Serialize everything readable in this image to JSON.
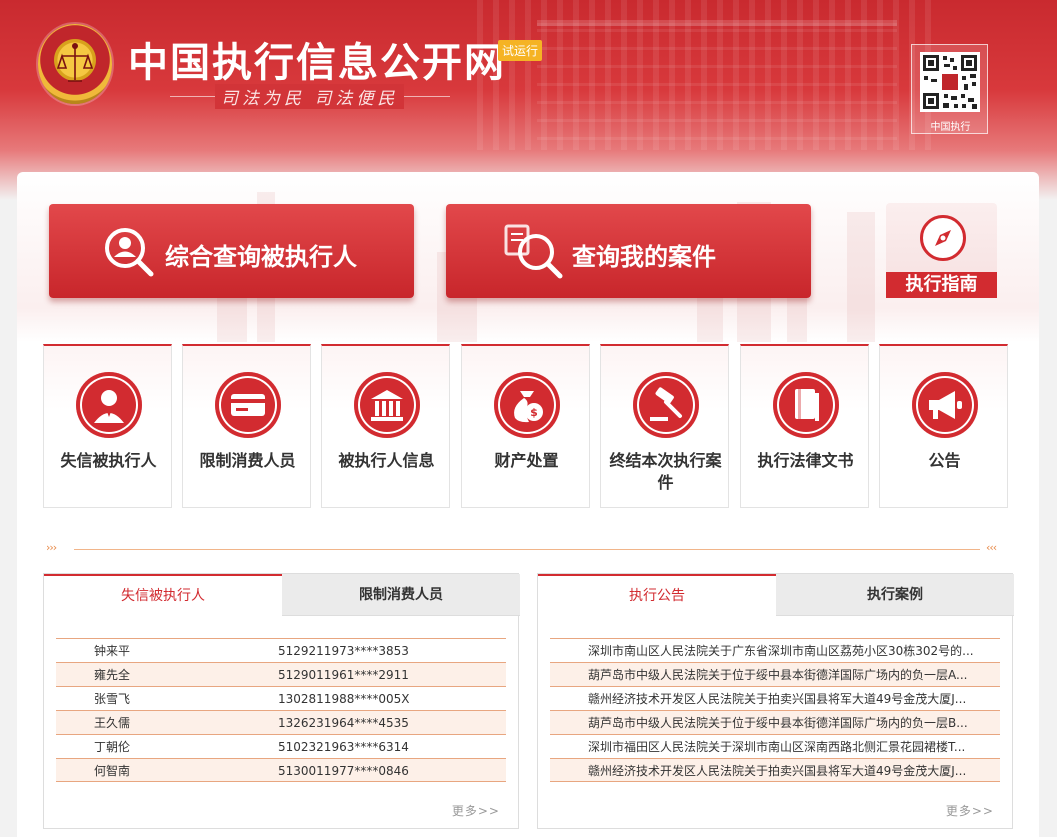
{
  "header": {
    "site_title": "中国执行信息公开网",
    "beta_badge": "试运行",
    "slogan": "司法为民  司法便民",
    "qr_label": "中国执行",
    "icons": {
      "emblem": "national-emblem-icon",
      "qr": "qr-code-icon"
    }
  },
  "actions": {
    "query_executed": {
      "label": "综合查询被执行人",
      "icon": "person-search-icon"
    },
    "query_my_case": {
      "label": "查询我的案件",
      "icon": "document-search-icon"
    },
    "guide": {
      "label": "执行指南",
      "icon": "compass-icon"
    }
  },
  "tiles": [
    {
      "label": "失信被执行人",
      "icon": "person-icon"
    },
    {
      "label": "限制消费人员",
      "icon": "card-icon"
    },
    {
      "label": "被执行人信息",
      "icon": "courthouse-icon"
    },
    {
      "label": "财产处置",
      "icon": "money-bag-icon"
    },
    {
      "label": "终结本次执行案件",
      "icon": "gavel-icon"
    },
    {
      "label": "执行法律文书",
      "icon": "book-icon"
    },
    {
      "label": "公告",
      "icon": "megaphone-icon"
    }
  ],
  "divider": {
    "left": "›››",
    "right": "‹‹‹"
  },
  "left_panel": {
    "tabs": [
      "失信被执行人",
      "限制消费人员"
    ],
    "active_tab": 0,
    "rows": [
      {
        "name": "钟来平",
        "id": "5129211973****3853"
      },
      {
        "name": "雍先全",
        "id": "5129011961****2911"
      },
      {
        "name": "张雪飞",
        "id": "1302811988****005X"
      },
      {
        "name": "王久儒",
        "id": "1326231964****4535"
      },
      {
        "name": "丁朝伦",
        "id": "5102321963****6314"
      },
      {
        "name": "何智南",
        "id": "5130011977****0846"
      }
    ],
    "more": "更多>>"
  },
  "right_panel": {
    "tabs": [
      "执行公告",
      "执行案例"
    ],
    "active_tab": 0,
    "rows": [
      "深圳市南山区人民法院关于广东省深圳市南山区荔苑小区30栋302号的...",
      "葫芦岛市中级人民法院关于位于绥中县本街德洋国际广场内的负一层A...",
      "赣州经济技术开发区人民法院关于拍卖兴国县将军大道49号金茂大厦J...",
      "葫芦岛市中级人民法院关于位于绥中县本街德洋国际广场内的负一层B...",
      "深圳市福田区人民法院关于深圳市南山区深南西路北侧汇景花园裙楼T...",
      "赣州经济技术开发区人民法院关于拍卖兴国县将军大道49号金茂大厦J..."
    ],
    "more": "更多>>"
  },
  "colors": {
    "brand_red": "#d22b30",
    "accent_orange": "#e8a680",
    "badge_yellow": "#f5b324"
  }
}
